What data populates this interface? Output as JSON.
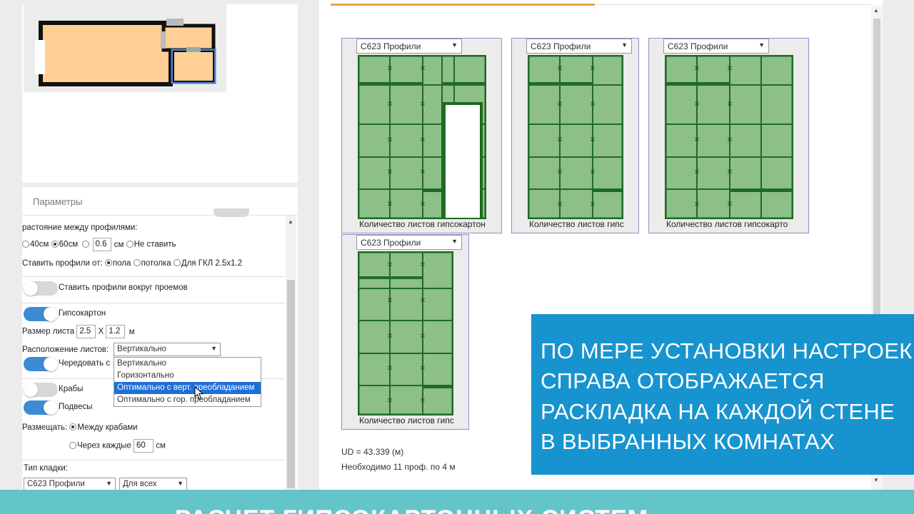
{
  "params": {
    "header": "Параметры",
    "spacing_label": "растояние между профилями:",
    "opt_40": "40см",
    "opt_60": "60см",
    "custom_value": "0.6",
    "unit_cm": "см",
    "opt_none": "Не ставить",
    "from_label": "Ставить профили от:",
    "from_floor": "пола",
    "from_ceiling": "потолка",
    "from_gkl": "Для ГКЛ 2.5x1.2",
    "around_openings": "Ставить профили вокруг проемов",
    "drywall": "Гипсокартон",
    "sheet_size_label": "Размер листа",
    "sheet_w": "2.5",
    "sheet_x": "X",
    "sheet_h": "1.2",
    "unit_m": "м",
    "layout_label": "Расположение листов:",
    "layout_value": "Вертикально",
    "alternate": "Чередовать с",
    "crabs": "Крабы",
    "hangers": "Подвесы",
    "place_label": "Размещать:",
    "place_between": "Между крабами",
    "place_every": "Через каждые",
    "every_value": "60",
    "masonry_label": "Тип кладки:",
    "masonry_profile": "С623 Профили",
    "masonry_scope": "Для всех"
  },
  "dropdown_options": [
    "Вертикально",
    "Горизонтально",
    "Оптимально с верт. преобладанием",
    "Оптимально с гор. преобладанием"
  ],
  "dropdown_selected_index": 2,
  "walls": [
    {
      "select": "С623 Профили",
      "caption": "Количество листов гипсокартон"
    },
    {
      "select": "С623 Профили",
      "caption": "Количество листов гипс"
    },
    {
      "select": "С623 Профили",
      "caption": "Количество листов гипсокарто"
    },
    {
      "select": "С623 Профили",
      "caption": "Количество листов гипс"
    }
  ],
  "ud_text": "UD = 43.339 (м)",
  "need_text": "Необходимо 11 проф. по 4 м",
  "overlay_lines": [
    "ПО МЕРЕ УСТАНОВКИ НАСТРОЕК",
    "СПРАВА ОТОБРАЖАЕТСЯ",
    "РАСКЛАДКА НА КАЖДОЙ СТЕНЕ",
    "В ВЫБРАННЫХ КОМНАТАХ"
  ],
  "bottom_title": "РАСЧЕТ ГИПСОКАРТОННЫХ СИСТЕМ",
  "colors": {
    "panel_green": "#8dbf88",
    "profile_green": "#1f6b22",
    "overlay_blue": "#1794cf",
    "band_teal": "#64c5c9",
    "room_fill": "#ffcf96"
  }
}
